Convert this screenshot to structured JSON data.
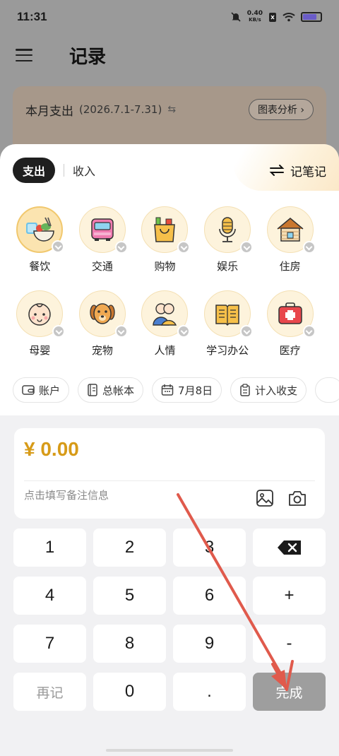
{
  "status_bar": {
    "time": "11:31",
    "net_speed_value": "0.40",
    "net_speed_unit": "KB/s"
  },
  "header": {
    "title": "记录"
  },
  "summary": {
    "title": "本月支出",
    "range": "(2026.7.1-7.31)",
    "swap_symbol": "⇆",
    "analysis_label": "图表分析"
  },
  "type_tabs": {
    "expense": "支出",
    "income": "收入"
  },
  "note_switch": {
    "label": "记笔记"
  },
  "categories": [
    {
      "label": "餐饮",
      "icon": "bento-icon",
      "selected": true
    },
    {
      "label": "交通",
      "icon": "bus-icon",
      "selected": false
    },
    {
      "label": "购物",
      "icon": "shopping-bag-icon",
      "selected": false
    },
    {
      "label": "娱乐",
      "icon": "microphone-icon",
      "selected": false
    },
    {
      "label": "住房",
      "icon": "house-icon",
      "selected": false
    },
    {
      "label": "母婴",
      "icon": "baby-face-icon",
      "selected": false
    },
    {
      "label": "宠物",
      "icon": "dog-icon",
      "selected": false
    },
    {
      "label": "人情",
      "icon": "people-icon",
      "selected": false
    },
    {
      "label": "学习办公",
      "icon": "book-icon",
      "selected": false
    },
    {
      "label": "医疗",
      "icon": "medical-kit-icon",
      "selected": false
    }
  ],
  "chips": {
    "account": "账户",
    "ledger": "总帐本",
    "date": "7月8日",
    "count_in": "计入收支"
  },
  "amount": {
    "value": "¥ 0.00",
    "color": "#d79b18"
  },
  "note": {
    "placeholder": "点击填写备注信息"
  },
  "keypad": {
    "k1": "1",
    "k2": "2",
    "k3": "3",
    "k4": "4",
    "k5": "5",
    "k6": "6",
    "k7": "7",
    "k8": "8",
    "k9": "9",
    "k0": "0",
    "dot": ".",
    "plus": "+",
    "minus": "-",
    "again": "再记",
    "done": "完成"
  },
  "colors": {
    "accent": "#d79b18",
    "arrow": "#e05a4c",
    "done_bg": "#9e9e9e"
  }
}
